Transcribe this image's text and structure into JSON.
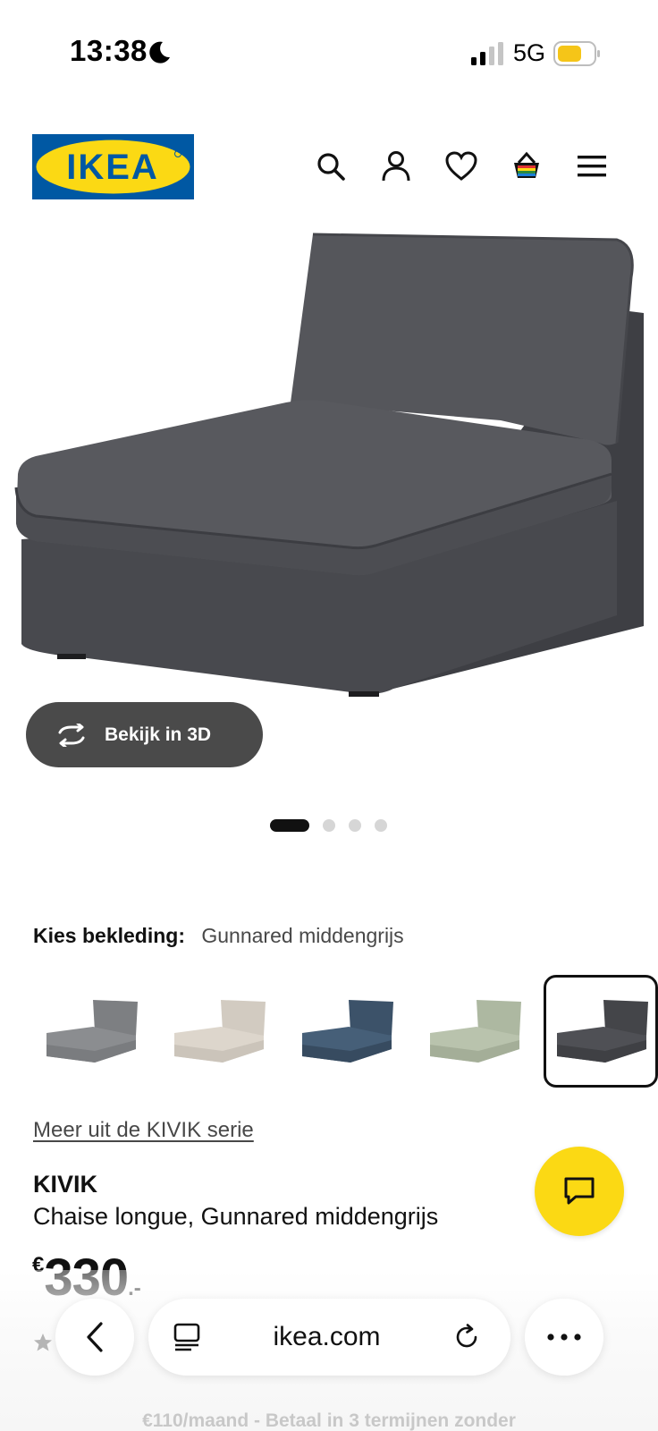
{
  "status_bar": {
    "time": "13:38",
    "network": "5G",
    "battery_color": "#f5c518"
  },
  "header": {
    "logo_text": "IKEA",
    "brand_colors": {
      "blue": "#0058a3",
      "yellow": "#fbd914"
    },
    "icons": [
      "search-icon",
      "account-icon",
      "heart-icon",
      "cart-icon",
      "menu-icon"
    ]
  },
  "gallery": {
    "view_3d_label": "Bekijk in 3D",
    "image_count": 4,
    "active_index": 0
  },
  "upholstery": {
    "label": "Kies bekleding:",
    "selected_value": "Gunnared middengrijs",
    "swatches": [
      {
        "color": "#8b8d90",
        "selected": false
      },
      {
        "color": "#ddd6cc",
        "selected": false
      },
      {
        "color": "#465f78",
        "selected": false
      },
      {
        "color": "#b9c3ad",
        "selected": false
      },
      {
        "color": "#4a4b50",
        "selected": true
      }
    ]
  },
  "product": {
    "series_link": "Meer uit de KIVIK serie",
    "brand": "KIVIK",
    "description": "Chaise longue, Gunnared middengrijs",
    "price_currency": "€",
    "price_integer": "330",
    "price_decimal": ".-"
  },
  "browser": {
    "url": "ikea.com"
  },
  "promo_text": "€110/maand - Betaal in 3 termijnen zonder"
}
